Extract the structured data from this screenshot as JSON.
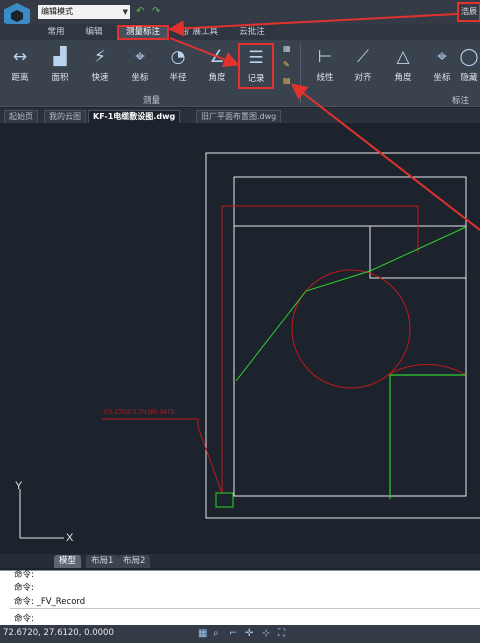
{
  "titlebar": {
    "mode_value": "编辑模式",
    "brand_text": "浩辰"
  },
  "menu_tabs": [
    "常用",
    "编辑",
    "测量标注",
    "扩展工具",
    "云批注"
  ],
  "ribbon": {
    "measure_tools": [
      "距离",
      "面积",
      "快速",
      "坐标",
      "半径",
      "角度",
      "记录"
    ],
    "measure_group_label": "测量",
    "annotate_tools": [
      "线性",
      "对齐",
      "角度",
      "坐标",
      "隐藏"
    ],
    "annotate_group_label": "标注"
  },
  "doc_tabs": [
    "起始页",
    "我的云图",
    "KF-1电缆敷设图.dwg",
    "旧厂平面布置图.dwg"
  ],
  "canvas": {
    "annotation_text": "FS-1TG2-5.7/15R/-3475",
    "ucs_x": "X",
    "ucs_y": "Y"
  },
  "layout_tabs": [
    "模型",
    "布局1",
    "布局2"
  ],
  "command_lines": [
    "命令:",
    "命令:",
    "命令: _FV_Record",
    "命令:"
  ],
  "status": {
    "coordinates": "72.6720, 27.6120, 0.0000"
  },
  "colors": {
    "highlight": "#e2322e",
    "drawing_red": "#c0191c",
    "drawing_green": "#2fd12f",
    "drawing_white": "#e8e8e8"
  }
}
